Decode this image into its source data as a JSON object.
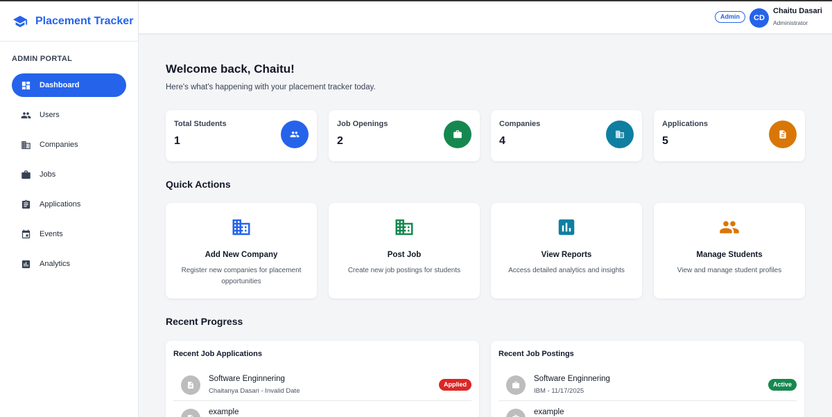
{
  "brand": {
    "title": "Placement Tracker",
    "icon": "graduation-cap-icon"
  },
  "sidebar": {
    "section_label": "ADMIN PORTAL",
    "items": [
      {
        "label": "Dashboard",
        "icon": "dashboard-icon",
        "active": true
      },
      {
        "label": "Users",
        "icon": "people-icon"
      },
      {
        "label": "Companies",
        "icon": "building-icon"
      },
      {
        "label": "Jobs",
        "icon": "briefcase-icon"
      },
      {
        "label": "Applications",
        "icon": "clipboard-icon"
      },
      {
        "label": "Events",
        "icon": "calendar-icon"
      },
      {
        "label": "Analytics",
        "icon": "chart-icon"
      }
    ]
  },
  "header": {
    "role_badge": "Admin",
    "avatar_initials": "CD",
    "user_name": "Chaitu Dasari",
    "user_role": "Administrator"
  },
  "main": {
    "welcome_title": "Welcome back, Chaitu!",
    "welcome_subtitle": "Here's what's happening with your placement tracker today.",
    "stats": [
      {
        "label": "Total Students",
        "value": "1",
        "color": "#2563eb",
        "icon": "people-icon"
      },
      {
        "label": "Job Openings",
        "value": "2",
        "color": "#16884f",
        "icon": "briefcase-icon"
      },
      {
        "label": "Companies",
        "value": "4",
        "color": "#0e7fa0",
        "icon": "building-icon"
      },
      {
        "label": "Applications",
        "value": "5",
        "color": "#d97706",
        "icon": "document-icon"
      }
    ],
    "quick_actions_title": "Quick Actions",
    "quick_actions": [
      {
        "title": "Add New Company",
        "description": "Register new companies for placement opportunities",
        "color": "#2563eb",
        "icon": "building-icon"
      },
      {
        "title": "Post Job",
        "description": "Create new job postings for students",
        "color": "#16884f",
        "icon": "building-icon"
      },
      {
        "title": "View Reports",
        "description": "Access detailed analytics and insights",
        "color": "#0e7fa0",
        "icon": "chart-icon"
      },
      {
        "title": "Manage Students",
        "description": "View and manage student profiles",
        "color": "#d97706",
        "icon": "people-icon"
      }
    ],
    "recent_progress_title": "Recent Progress",
    "recent_applications": {
      "title": "Recent Job Applications",
      "items": [
        {
          "title": "Software Enginnering",
          "subtitle": "Chaitanya Dasari - Invalid Date",
          "status": "Applied",
          "status_color": "#dc2626"
        },
        {
          "title": "example",
          "subtitle": "",
          "status": ""
        }
      ]
    },
    "recent_postings": {
      "title": "Recent Job Postings",
      "items": [
        {
          "title": "Software Enginnering",
          "subtitle": "IBM - 11/17/2025",
          "status": "Active",
          "status_color": "#16884f"
        },
        {
          "title": "example",
          "subtitle": "",
          "status": ""
        }
      ]
    }
  }
}
